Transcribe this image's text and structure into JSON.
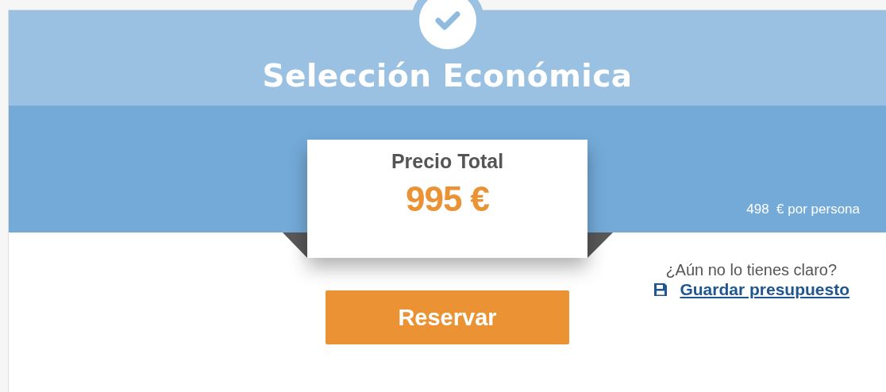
{
  "header": {
    "title": "Selección Económica"
  },
  "price_card": {
    "label": "Precio Total",
    "amount": "995 €"
  },
  "per_person": "498  € por persona",
  "save_prompt": {
    "question": "¿Aún no lo tienes claro?",
    "link": "Guardar presupuesto"
  },
  "buttons": [
    "Reservar"
  ]
}
